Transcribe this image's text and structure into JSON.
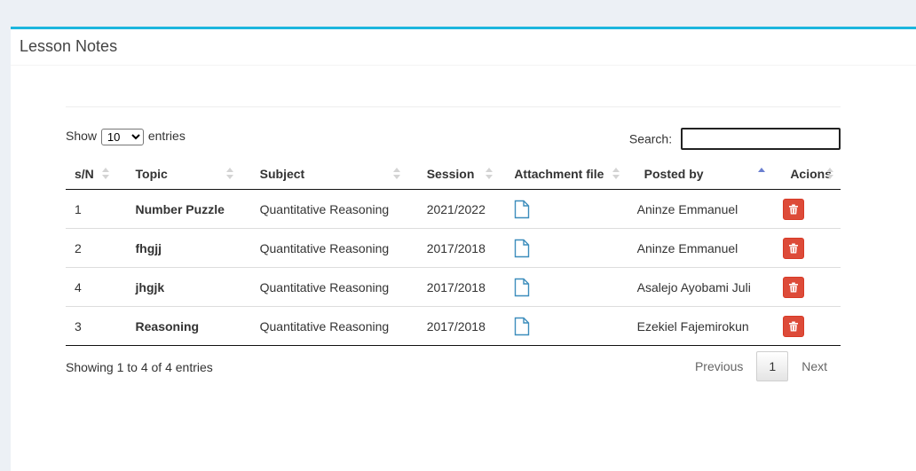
{
  "box": {
    "title": "Lesson Notes"
  },
  "controls": {
    "show_label": "Show",
    "entries_value": "10",
    "entries_label": "entries",
    "search_label": "Search:",
    "search_value": ""
  },
  "table": {
    "headers": [
      "s/N",
      "Topic",
      "Subject",
      "Session",
      "Attachment file",
      "Posted by",
      "Acions"
    ],
    "rows": [
      {
        "sn": "1",
        "topic": "Number Puzzle",
        "subject": "Quantitative Reasoning",
        "session": "2021/2022",
        "posted_by": "Aninze Emmanuel"
      },
      {
        "sn": "2",
        "topic": "fhgjj",
        "subject": "Quantitative Reasoning",
        "session": "2017/2018",
        "posted_by": "Aninze Emmanuel"
      },
      {
        "sn": "4",
        "topic": "jhgjk",
        "subject": "Quantitative Reasoning",
        "session": "2017/2018",
        "posted_by": "Asalejo Ayobami Juli"
      },
      {
        "sn": "3",
        "topic": "Reasoning",
        "subject": "Quantitative Reasoning",
        "session": "2017/2018",
        "posted_by": "Ezekiel Fajemirokun"
      }
    ]
  },
  "footer": {
    "info": "Showing 1 to 4 of 4 entries",
    "previous": "Previous",
    "page": "1",
    "next": "Next"
  },
  "icons": {
    "attachment": "file-icon",
    "delete": "trash-icon"
  },
  "colors": {
    "accent": "#1cb6de",
    "danger": "#dd4b39",
    "file_icon": "#3c8dbc"
  }
}
